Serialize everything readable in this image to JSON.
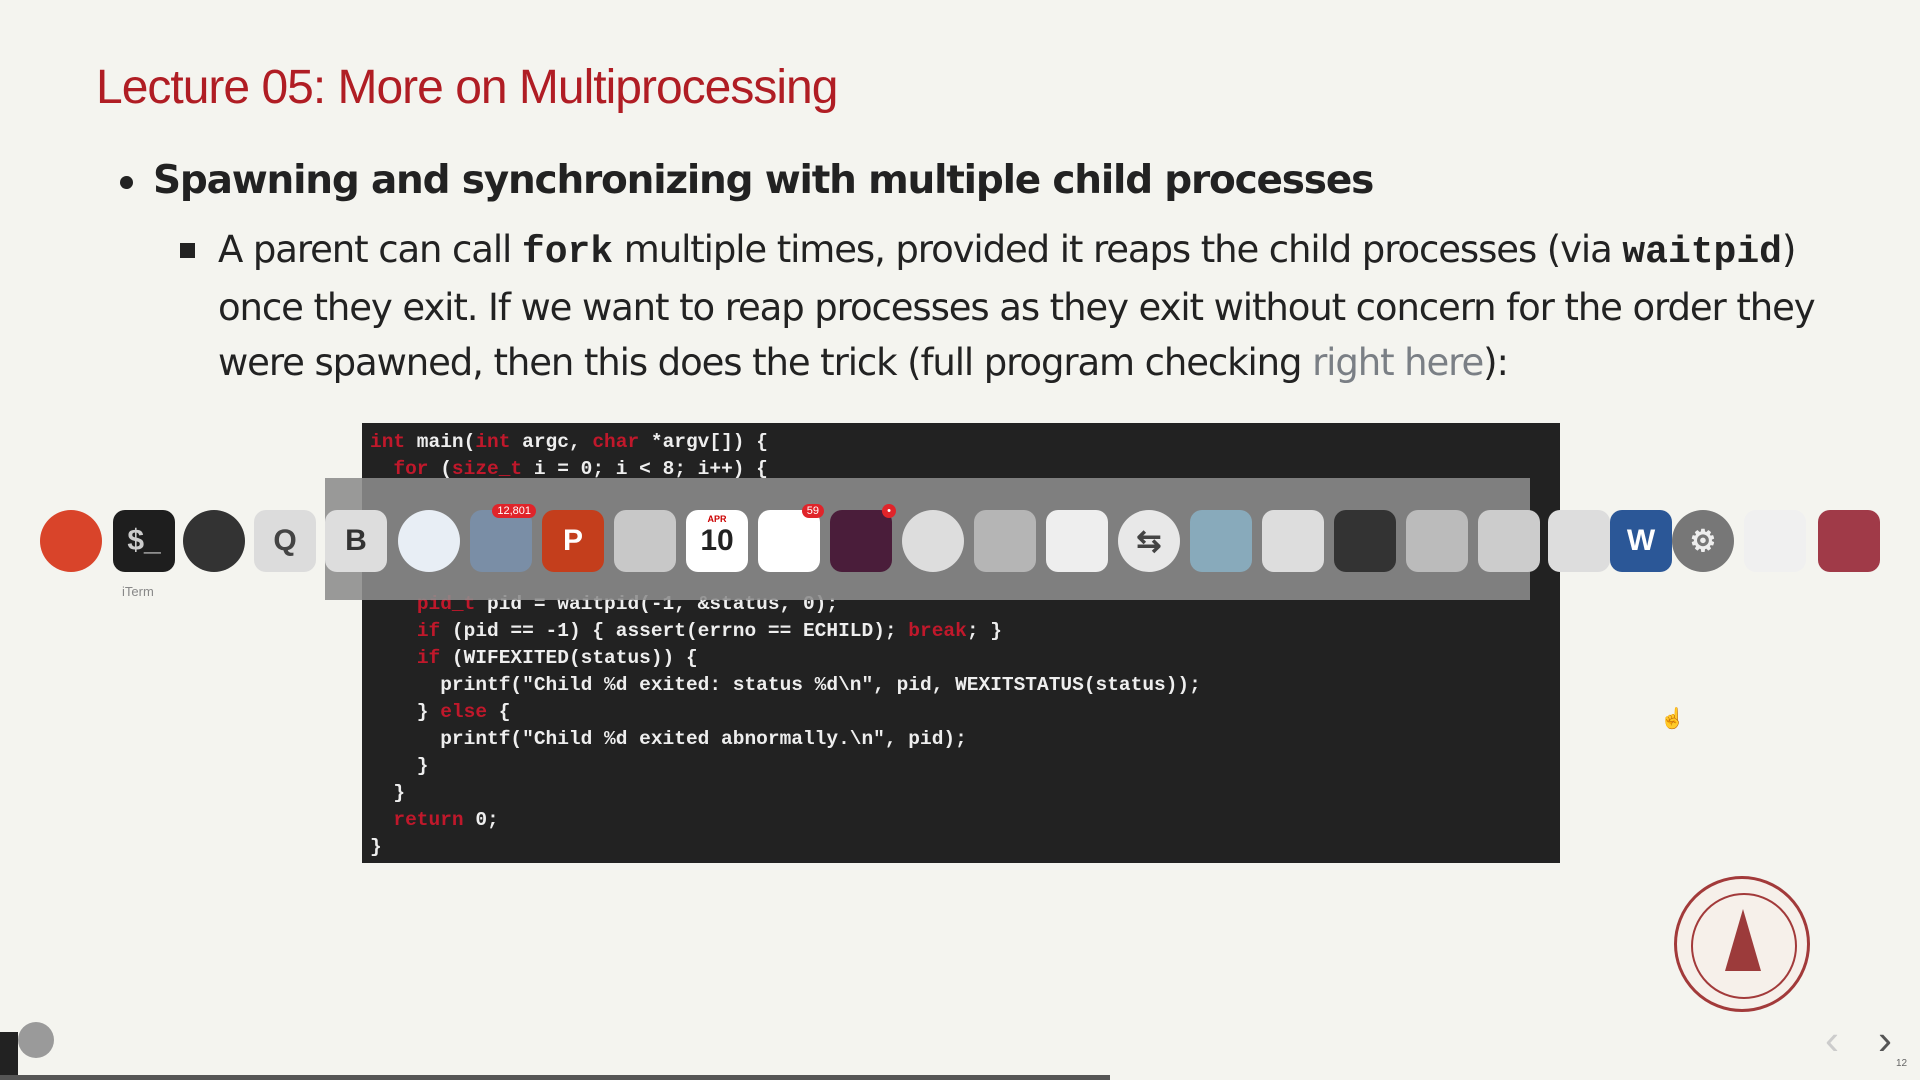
{
  "slide": {
    "title": "Lecture 05: More on Multiprocessing",
    "bullet1": "Spawning and synchronizing with multiple child processes",
    "bullet2": {
      "t1": "A parent can call ",
      "c1": "fork",
      "t2": " multiple times, provided it reaps the child processes (via ",
      "c2": "waitpid",
      "t3": ") once they exit. If we want to reap processes as they exit without concern for the order they were spawned, then this does the trick (full program checking ",
      "link": "right here",
      "t4": "):"
    }
  },
  "code": {
    "lines": [
      [
        {
          "k": "int"
        },
        {
          "t": " main("
        },
        {
          "k": "int"
        },
        {
          "t": " argc, "
        },
        {
          "k": "char"
        },
        {
          "t": " *argv[]) {"
        }
      ],
      [
        {
          "t": "  "
        },
        {
          "k": "for"
        },
        {
          "t": " ("
        },
        {
          "k": "size_t"
        },
        {
          "t": " i = 0; i < 8; i++) {"
        }
      ],
      [
        {
          "t": ""
        }
      ],
      [
        {
          "t": ""
        }
      ],
      [
        {
          "t": ""
        }
      ],
      [
        {
          "t": ""
        }
      ],
      [
        {
          "t": "    "
        },
        {
          "k": "pid_t"
        },
        {
          "t": " pid = waitpid(-1, &status, 0);"
        }
      ],
      [
        {
          "t": "    "
        },
        {
          "k": "if"
        },
        {
          "t": " (pid == -1) { assert(errno == ECHILD); "
        },
        {
          "k": "break"
        },
        {
          "t": "; }"
        }
      ],
      [
        {
          "t": "    "
        },
        {
          "k": "if"
        },
        {
          "t": " (WIFEXITED(status)) {"
        }
      ],
      [
        {
          "t": "      printf(\"Child %d exited: status %d\\n\", pid, WEXITSTATUS(status));"
        }
      ],
      [
        {
          "t": "    } "
        },
        {
          "k": "else"
        },
        {
          "t": " {"
        }
      ],
      [
        {
          "t": "      printf(\"Child %d exited abnormally.\\n\", pid);"
        }
      ],
      [
        {
          "t": "    }"
        }
      ],
      [
        {
          "t": "  }"
        }
      ],
      [
        {
          "t": "  "
        },
        {
          "k": "return"
        },
        {
          "t": " 0;"
        }
      ],
      [
        {
          "t": "}"
        }
      ]
    ]
  },
  "dock": {
    "terminal_label": "iTerm",
    "icons": [
      {
        "name": "firefox-icon",
        "glyph": "",
        "bg": "#d9442a",
        "fg": "#fff"
      },
      {
        "name": "iterm-icon",
        "glyph": "$_",
        "bg": "#1e1e1e",
        "fg": "#ccc"
      },
      {
        "name": "alfred-icon",
        "glyph": "",
        "bg": "#333",
        "fg": "#ddd"
      },
      {
        "name": "quicktime-icon",
        "glyph": "Q",
        "bg": "#dcdcdc",
        "fg": "#444"
      },
      {
        "name": "bbedit-icon",
        "glyph": "B",
        "bg": "#ddd",
        "fg": "#333"
      },
      {
        "name": "safari-icon",
        "glyph": "",
        "bg": "#e8eef5",
        "fg": "#c00"
      },
      {
        "name": "mail-icon",
        "glyph": "",
        "bg": "#7a8ea6",
        "fg": "#fff",
        "badge": "12,801"
      },
      {
        "name": "powerpoint-icon",
        "glyph": "P",
        "bg": "#c43e1c",
        "fg": "#fff"
      },
      {
        "name": "messages-icon",
        "glyph": "",
        "bg": "#c8c8c8",
        "fg": "#555"
      },
      {
        "name": "calendar-icon",
        "glyph": "10",
        "bg": "#fff",
        "fg": "#222",
        "sub": "APR"
      },
      {
        "name": "reminders-icon",
        "glyph": "",
        "bg": "#fff",
        "fg": "#444",
        "badge": "59"
      },
      {
        "name": "slack-icon",
        "glyph": "",
        "bg": "#4a1d3a",
        "fg": "#fff",
        "badge": "•"
      },
      {
        "name": "chrome-icon",
        "glyph": "",
        "bg": "#ddd",
        "fg": "#333"
      },
      {
        "name": "preview-icon",
        "glyph": "",
        "bg": "#b5b5b5",
        "fg": "#333"
      },
      {
        "name": "textedit-icon",
        "glyph": "",
        "bg": "#eee",
        "fg": "#333"
      },
      {
        "name": "teamviewer-icon",
        "glyph": "⇆",
        "bg": "#e8e8e8",
        "fg": "#444"
      },
      {
        "name": "finder-icon",
        "glyph": "",
        "bg": "#8ab",
        "fg": "#fff"
      },
      {
        "name": "photos-browser-icon",
        "glyph": "",
        "bg": "#ddd",
        "fg": "#555"
      },
      {
        "name": "final-cut-icon",
        "glyph": "",
        "bg": "#333",
        "fg": "#ddd"
      },
      {
        "name": "keynote-icon",
        "glyph": "",
        "bg": "#bbb",
        "fg": "#333"
      },
      {
        "name": "image-editor-icon",
        "glyph": "",
        "bg": "#ccc",
        "fg": "#a33"
      },
      {
        "name": "skitch-icon",
        "glyph": "",
        "bg": "#ddd",
        "fg": "#c00"
      },
      {
        "name": "word-icon",
        "glyph": "W",
        "bg": "#2b5797",
        "fg": "#fff"
      },
      {
        "name": "system-preferences-icon",
        "glyph": "⚙",
        "bg": "#777",
        "fg": "#eee"
      },
      {
        "name": "folder-icon",
        "glyph": "",
        "bg": "#f0f0f0",
        "fg": "#999"
      },
      {
        "name": "book-icon",
        "glyph": "",
        "bg": "#a03a48",
        "fg": "#fff"
      }
    ]
  },
  "nav": {
    "prev": "‹",
    "next": "›",
    "page": "12"
  }
}
